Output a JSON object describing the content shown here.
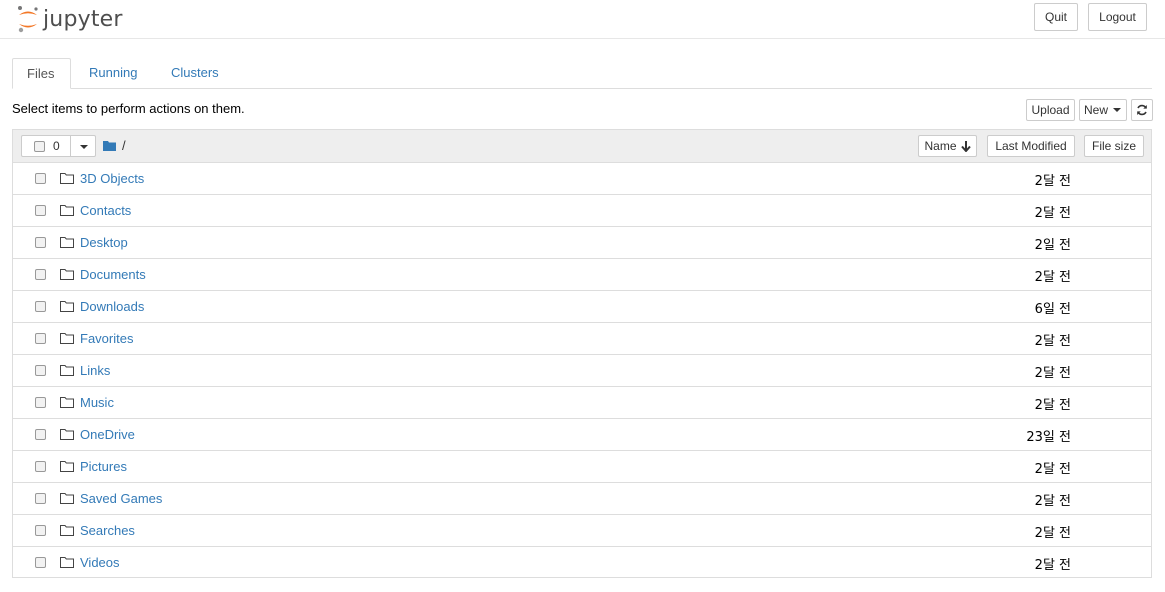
{
  "header": {
    "logo_text": "jupyter",
    "quit_label": "Quit",
    "logout_label": "Logout"
  },
  "tabs": [
    {
      "label": "Files",
      "active": true
    },
    {
      "label": "Running",
      "active": false
    },
    {
      "label": "Clusters",
      "active": false
    }
  ],
  "toolbar": {
    "helper_text": "Select items to perform actions on them.",
    "upload_label": "Upload",
    "new_label": "New",
    "refresh_icon": "refresh-icon"
  },
  "list_header": {
    "selected_count": "0",
    "breadcrumb": "/",
    "name_label": "Name",
    "last_modified_label": "Last Modified",
    "file_size_label": "File size"
  },
  "items": [
    {
      "name": "3D Objects",
      "modified": "2달 전"
    },
    {
      "name": "Contacts",
      "modified": "2달 전"
    },
    {
      "name": "Desktop",
      "modified": "2일 전"
    },
    {
      "name": "Documents",
      "modified": "2달 전"
    },
    {
      "name": "Downloads",
      "modified": "6일 전"
    },
    {
      "name": "Favorites",
      "modified": "2달 전"
    },
    {
      "name": "Links",
      "modified": "2달 전"
    },
    {
      "name": "Music",
      "modified": "2달 전"
    },
    {
      "name": "OneDrive",
      "modified": "23일 전"
    },
    {
      "name": "Pictures",
      "modified": "2달 전"
    },
    {
      "name": "Saved Games",
      "modified": "2달 전"
    },
    {
      "name": "Searches",
      "modified": "2달 전"
    },
    {
      "name": "Videos",
      "modified": "2달 전"
    }
  ],
  "colors": {
    "link": "#337ab7",
    "logo_orange": "#f37726",
    "header_bg": "#eeeeee"
  }
}
